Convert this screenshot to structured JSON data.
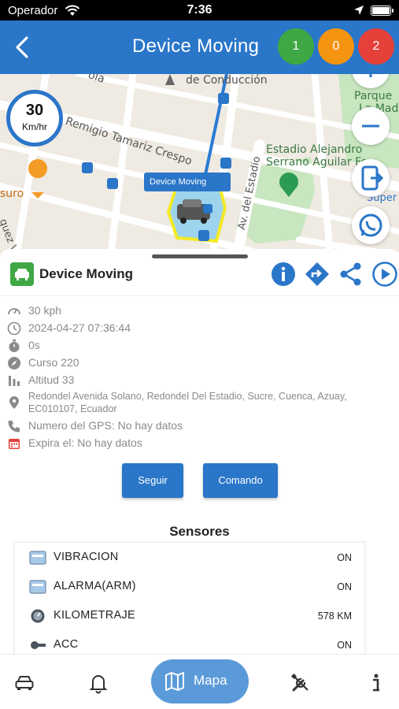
{
  "status_bar": {
    "carrier": "Operador",
    "time": "7:36"
  },
  "header": {
    "title": "Device Moving",
    "badges": [
      "1",
      "0",
      "2"
    ]
  },
  "map": {
    "labels": {
      "road_top": "de Conducción",
      "road_top_left": "ola",
      "street_remigio": "Remigio Tamariz Crespo",
      "street_estadio": "Av. del Estadio",
      "park": "Parque",
      "park2": "La Mad",
      "stadium": "Estadio Alejandro",
      "stadium2": "Serrano Aguilar Fe",
      "left_poi": "suro",
      "left_street": "quez V.",
      "super": "Super"
    },
    "speed": {
      "value": "30",
      "unit": "Km/hr"
    },
    "vehicle_tag": "Device Moving"
  },
  "device": {
    "name": "Device Moving",
    "info": [
      {
        "icon": "speedometer-icon",
        "text": "30 kph"
      },
      {
        "icon": "clock-icon",
        "text": "2024-04-27 07:36:44"
      },
      {
        "icon": "stopwatch-icon",
        "text": "0s"
      },
      {
        "icon": "compass-icon",
        "text": "Curso 220"
      },
      {
        "icon": "altitude-icon",
        "text": "Altitud 33"
      },
      {
        "icon": "location-pin-icon",
        "text": "Redondel Avenida Solano, Redondel Del Estadio, Sucre, Cuenca, Azuay, EC010107, Ecuador"
      },
      {
        "icon": "phone-icon",
        "text": "Numero del GPS: No hay datos"
      },
      {
        "icon": "calendar-icon",
        "text": "Expira el: No hay datos"
      }
    ],
    "buttons": {
      "follow": "Seguir",
      "command": "Comando"
    }
  },
  "sensors": {
    "title": "Sensores",
    "items": [
      {
        "name": "VIBRACION",
        "value": "ON"
      },
      {
        "name": "ALARMA(ARM)",
        "value": "ON"
      },
      {
        "name": "KILOMETRAJE",
        "value": "578 KM"
      },
      {
        "name": "ACC",
        "value": "ON"
      }
    ]
  },
  "nav": {
    "map_label": "Mapa"
  },
  "colors": {
    "primary": "#2a76c9",
    "green": "#3fa844",
    "orange": "#f59411",
    "red": "#e5413a"
  }
}
